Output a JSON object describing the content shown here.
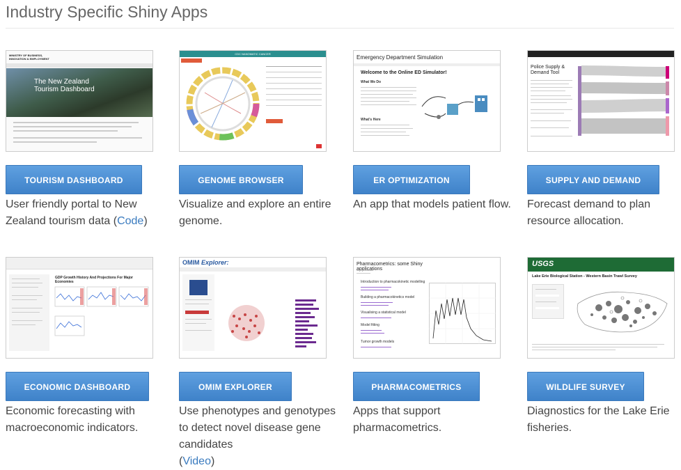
{
  "page": {
    "title": "Industry Specific Shiny Apps"
  },
  "apps": [
    {
      "button": "TOURISM DASHBOARD",
      "desc_before": "User friendly portal to New Zealand tourism data (",
      "link": "Code",
      "desc_after": ")",
      "thumb": {
        "header_text": "MINISTRY OF BUSINESS, INNOVATION & EMPLOYMENT",
        "banner_text": "The New Zealand Tourism Dashboard"
      }
    },
    {
      "button": "GENOME BROWSER",
      "desc": "Visualize and explore an entire genome.",
      "thumb": {
        "header_text": "CDC NANOMATIC CANCER"
      }
    },
    {
      "button": "ER OPTIMIZATION",
      "desc": "An app that models patient flow.",
      "thumb": {
        "app_title": "Emergency Department Simulation",
        "welcome": "Welcome to the Online ED Simulator!",
        "what_we_do": "What We Do",
        "whats_here": "What's Here"
      }
    },
    {
      "button": "SUPPLY AND DEMAND",
      "desc": "Forecast demand to plan resource allocation.",
      "thumb": {
        "tool_title": "Police Supply & Demand Tool"
      }
    },
    {
      "button": "ECONOMIC DASHBOARD",
      "desc": "Economic forecasting with macroeconomic indicators.",
      "thumb": {
        "chart_title": "GDP Growth History And Projections For Major Economies"
      }
    },
    {
      "button": "OMIM EXPLORER",
      "desc": "Use phenotypes and genotypes to detect novel disease gene candidates",
      "link": "Video",
      "thumb": {
        "brand": "OMIM",
        "explorer": "Explorer:"
      }
    },
    {
      "button": "PHARMACOMETRICS",
      "desc": "Apps that support pharmacometrics.",
      "thumb": {
        "doc_title": "Pharmacometrics: some Shiny applications",
        "sections": [
          "Introduction to pharmacokinetic modelling",
          "Building a pharmacokinetics model",
          "Visualising a statistical model",
          "Model fitting",
          "Tumor growth models"
        ]
      }
    },
    {
      "button": "WILDLIFE SURVEY",
      "desc": "Diagnostics for the Lake Erie fisheries.",
      "thumb": {
        "brand": "USGS",
        "survey_title": "Lake Erie Biological Station - Western Basin Trawl Survey"
      }
    }
  ],
  "colors": {
    "button_top": "#5fa0e0",
    "button_bottom": "#3f82c9",
    "link": "#3a7bbf",
    "usgs_green": "#1e6b35"
  }
}
